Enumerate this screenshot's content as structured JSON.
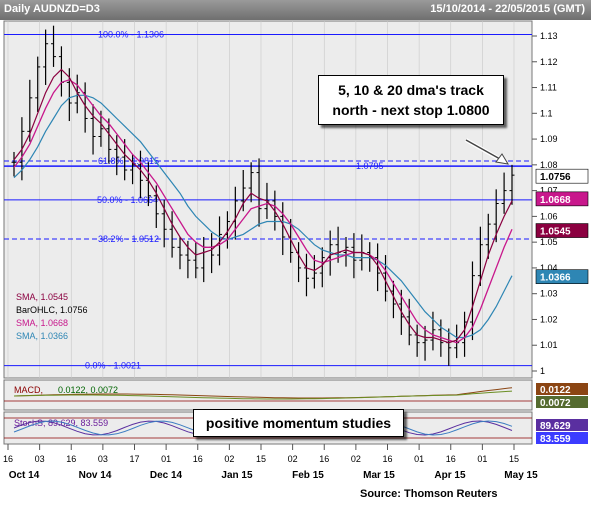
{
  "header": {
    "left": "Daily AUDNZD=D3",
    "right": "15/10/2014 - 22/05/2015 (GMT)"
  },
  "callout": {
    "line1": "5, 10 & 20 dma's track",
    "line2": "north - next stop 1.0800"
  },
  "momentum_label": "positive momentum studies",
  "source": "Source: Thomson Reuters",
  "colors": {
    "ohlc": "#000000",
    "sma_fast": "#8b0040",
    "sma_mid": "#c8188c",
    "sma_slow": "#2e86b4",
    "fib": "#1a1aff",
    "callout_fill": "#ffffff"
  },
  "chart_data": {
    "type": "ohlc",
    "ylim": [
      1.0,
      1.13
    ],
    "y_ticks": [
      "1.13",
      "1.12",
      "1.11",
      "1.1",
      "1.09",
      "1.08",
      "1.07",
      "1.06",
      "1.05",
      "1.04",
      "1.03",
      "1.02",
      "1.01",
      "1"
    ],
    "x_day_labels": [
      "16",
      "03",
      "16",
      "03",
      "17",
      "01",
      "16",
      "02",
      "15",
      "02",
      "16",
      "02",
      "16",
      "01",
      "16",
      "01",
      "15"
    ],
    "x_month_labels": [
      "Oct 14",
      "Nov 14",
      "Dec 14",
      "Jan 15",
      "Feb 15",
      "Mar 15",
      "Apr 15",
      "May 15"
    ],
    "fib_levels": [
      {
        "label": "100.0%",
        "value_text": "1.1306",
        "value": 1.1306,
        "style": "solid"
      },
      {
        "label": "61.8%",
        "value_text": "1.0815",
        "value": 1.0815,
        "style": "dashed"
      },
      {
        "label": "50.0%",
        "value_text": "1.0664",
        "value": 1.0664,
        "style": "solid"
      },
      {
        "label": "38.2%",
        "value_text": "1.0512",
        "value": 1.0512,
        "style": "dashed"
      },
      {
        "label": "0.0%",
        "value_text": "1.0021",
        "value": 1.0021,
        "style": "solid"
      }
    ],
    "resistance_line": {
      "value_text": "1.0795",
      "value": 1.0795
    },
    "legend": [
      {
        "name": "SMA",
        "value": "1.0545"
      },
      {
        "name": "BarOHLC",
        "value": "1.0756"
      },
      {
        "name": "SMA",
        "value": "1.0668"
      },
      {
        "name": "SMA",
        "value": "1.0366"
      }
    ],
    "badges": [
      {
        "text": "1.0756",
        "value": 1.0756
      },
      {
        "text": "1.0668",
        "value": 1.0668
      },
      {
        "text": "1.0545",
        "value": 1.0545
      },
      {
        "text": "1.0366",
        "value": 1.0366
      }
    ],
    "close_series": [
      1.081,
      1.093,
      1.106,
      1.118,
      1.127,
      1.122,
      1.112,
      1.104,
      1.108,
      1.098,
      1.091,
      1.094,
      1.086,
      1.083,
      1.078,
      1.08,
      1.074,
      1.068,
      1.061,
      1.055,
      1.048,
      1.045,
      1.043,
      1.04,
      1.048,
      1.045,
      1.053,
      1.058,
      1.066,
      1.071,
      1.077,
      1.063,
      1.066,
      1.06,
      1.052,
      1.046,
      1.04,
      1.036,
      1.038,
      1.044,
      1.049,
      1.046,
      1.048,
      1.043,
      1.046,
      1.044,
      1.038,
      1.031,
      1.026,
      1.021,
      1.014,
      1.011,
      1.012,
      1.016,
      1.011,
      1.009,
      1.011,
      1.019,
      1.037,
      1.049,
      1.057,
      1.065,
      1.07,
      1.076
    ],
    "sma_fast": [
      1.082,
      1.086,
      1.092,
      1.1,
      1.108,
      1.114,
      1.117,
      1.114,
      1.108,
      1.103,
      1.099,
      1.096,
      1.092,
      1.088,
      1.084,
      1.081,
      1.078,
      1.074,
      1.069,
      1.063,
      1.057,
      1.052,
      1.048,
      1.045,
      1.046,
      1.047,
      1.05,
      1.054,
      1.059,
      1.065,
      1.069,
      1.067,
      1.066,
      1.062,
      1.057,
      1.051,
      1.045,
      1.04,
      1.039,
      1.041,
      1.045,
      1.046,
      1.047,
      1.046,
      1.046,
      1.045,
      1.041,
      1.035,
      1.029,
      1.023,
      1.018,
      1.014,
      1.013,
      1.013,
      1.012,
      1.011,
      1.012,
      1.016,
      1.025,
      1.035,
      1.045,
      1.053,
      1.06,
      1.066
    ],
    "sma_mid": [
      1.079,
      1.083,
      1.088,
      1.095,
      1.102,
      1.108,
      1.112,
      1.113,
      1.111,
      1.107,
      1.103,
      1.099,
      1.096,
      1.092,
      1.088,
      1.084,
      1.081,
      1.077,
      1.073,
      1.068,
      1.063,
      1.058,
      1.053,
      1.05,
      1.048,
      1.048,
      1.049,
      1.051,
      1.055,
      1.059,
      1.063,
      1.064,
      1.065,
      1.064,
      1.061,
      1.057,
      1.052,
      1.047,
      1.043,
      1.042,
      1.043,
      1.044,
      1.045,
      1.046,
      1.046,
      1.045,
      1.043,
      1.039,
      1.034,
      1.029,
      1.024,
      1.019,
      1.016,
      1.014,
      1.013,
      1.012,
      1.011,
      1.013,
      1.017,
      1.024,
      1.032,
      1.04,
      1.048,
      1.055
    ],
    "sma_slow": [
      1.075,
      1.078,
      1.082,
      1.087,
      1.093,
      1.098,
      1.103,
      1.106,
      1.107,
      1.107,
      1.106,
      1.104,
      1.101,
      1.098,
      1.095,
      1.092,
      1.089,
      1.085,
      1.081,
      1.077,
      1.073,
      1.069,
      1.064,
      1.06,
      1.057,
      1.054,
      1.052,
      1.051,
      1.052,
      1.053,
      1.055,
      1.057,
      1.058,
      1.058,
      1.058,
      1.057,
      1.055,
      1.052,
      1.049,
      1.047,
      1.046,
      1.045,
      1.045,
      1.044,
      1.044,
      1.044,
      1.043,
      1.041,
      1.038,
      1.035,
      1.031,
      1.027,
      1.023,
      1.02,
      1.017,
      1.015,
      1.013,
      1.013,
      1.014,
      1.016,
      1.02,
      1.025,
      1.031,
      1.037
    ],
    "macd": {
      "label": "MACD",
      "value1": "0.0122",
      "value2": "0.0072"
    },
    "stoch": {
      "label": "StochS",
      "value1": "89.629",
      "value2": "83.559"
    },
    "macd_badges": [
      {
        "text": "0.0122"
      },
      {
        "text": "0.0072"
      }
    ],
    "stoch_badges": [
      {
        "text": "89.629"
      },
      {
        "text": "83.559"
      }
    ]
  }
}
